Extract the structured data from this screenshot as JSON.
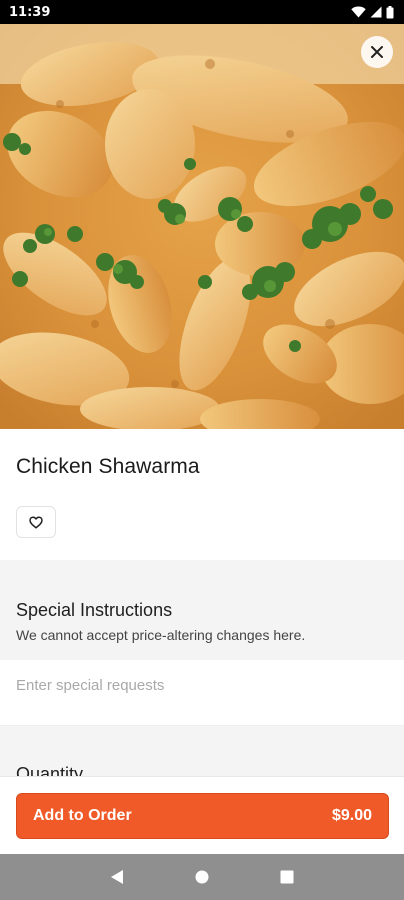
{
  "status_bar": {
    "time": "11:39",
    "icons": [
      "wifi-icon",
      "signal-icon",
      "battery-icon"
    ]
  },
  "hero": {
    "image": "chicken-shawarma-photo",
    "close_icon": "close-icon"
  },
  "item": {
    "title": "Chicken Shawarma",
    "favorite_icon": "heart-outline-icon"
  },
  "special_instructions": {
    "title": "Special Instructions",
    "subtitle": "We cannot accept price-altering changes here.",
    "placeholder": "Enter special requests",
    "value": ""
  },
  "quantity": {
    "label": "Quantity"
  },
  "order_button": {
    "label": "Add to Order",
    "price": "$9.00"
  },
  "nav": {
    "icons": [
      "back-icon",
      "home-icon",
      "recents-icon"
    ]
  },
  "colors": {
    "accent": "#f05a28",
    "status_bar": "#000000",
    "nav_bar": "#8f8f8f",
    "section_bg": "#f4f4f4"
  }
}
